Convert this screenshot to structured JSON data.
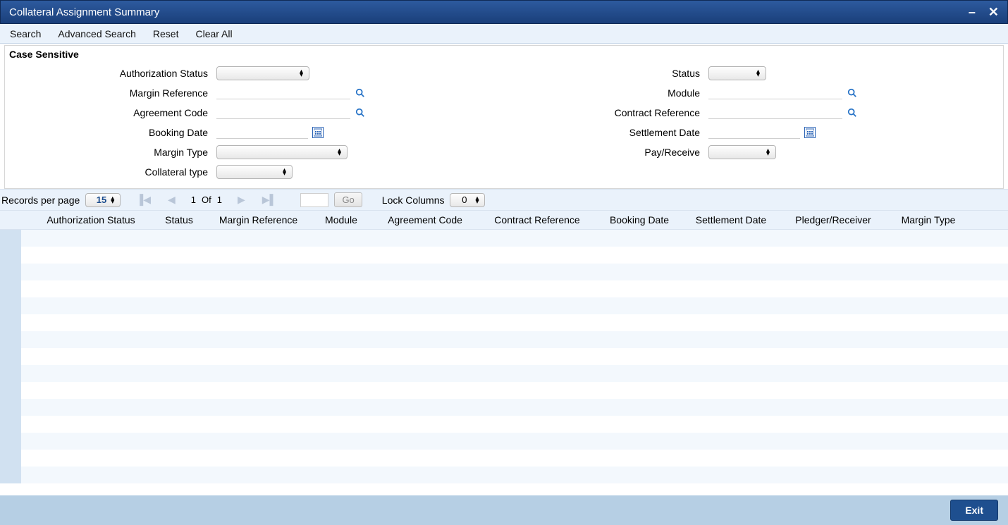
{
  "window": {
    "title": "Collateral Assignment Summary"
  },
  "toolbar": {
    "search": "Search",
    "advanced": "Advanced Search",
    "reset": "Reset",
    "clearall": "Clear All"
  },
  "panel": {
    "header": "Case Sensitive"
  },
  "fields": {
    "auth_status": "Authorization Status",
    "margin_ref": "Margin Reference",
    "agreement_code": "Agreement Code",
    "booking_date": "Booking Date",
    "margin_type": "Margin Type",
    "collateral_type": "Collateral type",
    "status": "Status",
    "module": "Module",
    "contract_ref": "Contract Reference",
    "settlement_date": "Settlement Date",
    "pay_receive": "Pay/Receive"
  },
  "pager": {
    "records_label": "Records per page",
    "records_value": "15",
    "page_current": "1",
    "page_of": "Of",
    "page_total": "1",
    "go": "Go",
    "lock_label": "Lock Columns",
    "lock_value": "0"
  },
  "columns": [
    "Authorization Status",
    "Status",
    "Margin Reference",
    "Module",
    "Agreement Code",
    "Contract Reference",
    "Booking Date",
    "Settlement Date",
    "Pledger/Receiver",
    "Margin Type"
  ],
  "footer": {
    "exit": "Exit"
  }
}
